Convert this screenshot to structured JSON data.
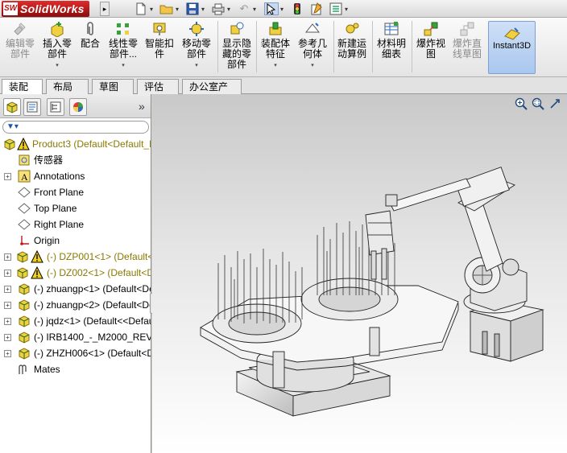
{
  "app": {
    "logo_mark": "SW",
    "title": "SolidWorks"
  },
  "quick_access": [
    {
      "name": "new-icon",
      "glyph": "🗋"
    },
    {
      "name": "open-icon",
      "glyph": "📂"
    },
    {
      "name": "save-icon",
      "glyph": "💾"
    },
    {
      "name": "print-icon",
      "glyph": "🖶"
    },
    {
      "name": "undo-icon",
      "glyph": "↶"
    },
    {
      "name": "select-icon",
      "glyph": "⬉"
    },
    {
      "name": "rebuild-icon",
      "glyph": "🚦"
    },
    {
      "name": "file-properties-icon",
      "glyph": "📝"
    },
    {
      "name": "options-icon",
      "glyph": "☷"
    }
  ],
  "ribbon": {
    "edit_component": "编辑零\n部件",
    "insert_component": "插入零\n部件",
    "mate": "配合",
    "linear_pattern": "线性零\n部件...",
    "smart_fasteners": "智能扣\n件",
    "move_component": "移动零\n部件",
    "show_hidden": "显示隐\n藏的零\n部件",
    "assembly_features": "装配体\n特征",
    "reference_geometry": "参考几\n何体",
    "new_motion_study": "新建运\n动算例",
    "bill_of_materials": "材料明\n细表",
    "exploded_view": "爆炸视\n图",
    "explode_line_sketch": "爆炸直\n线草图",
    "instant3d": "Instant3D"
  },
  "tabs": [
    "装配体",
    "布局",
    "草图",
    "评估",
    "办公室产品"
  ],
  "tree": {
    "root": "Product3  (Default<Default_Display State-1>)",
    "sensors": "传感器",
    "annotations": "Annotations",
    "front_plane": "Front Plane",
    "top_plane": "Top Plane",
    "right_plane": "Right Plane",
    "origin": "Origin",
    "comp1": "(-) DZP001<1>  (Default<Default_",
    "comp2": "(-) DZ002<1>  (Default<Default_",
    "comp3": "(-) zhuangp<1>  (Default<Default",
    "comp4": "(-) zhuangp<2>  (Default<Default",
    "comp5": "(-) jqdz<1>  (Default<<Default",
    "comp6": "(-) IRB1400_-_M2000_REV1<1>",
    "comp7": "(-) ZHZH006<1>  (Default<Default",
    "mates": "Mates"
  },
  "colors": {
    "warning": "#e8c200",
    "part_yellow": "#f2d64b",
    "part_green": "#2f9a2f",
    "accent_blue": "#3a6fc2"
  }
}
